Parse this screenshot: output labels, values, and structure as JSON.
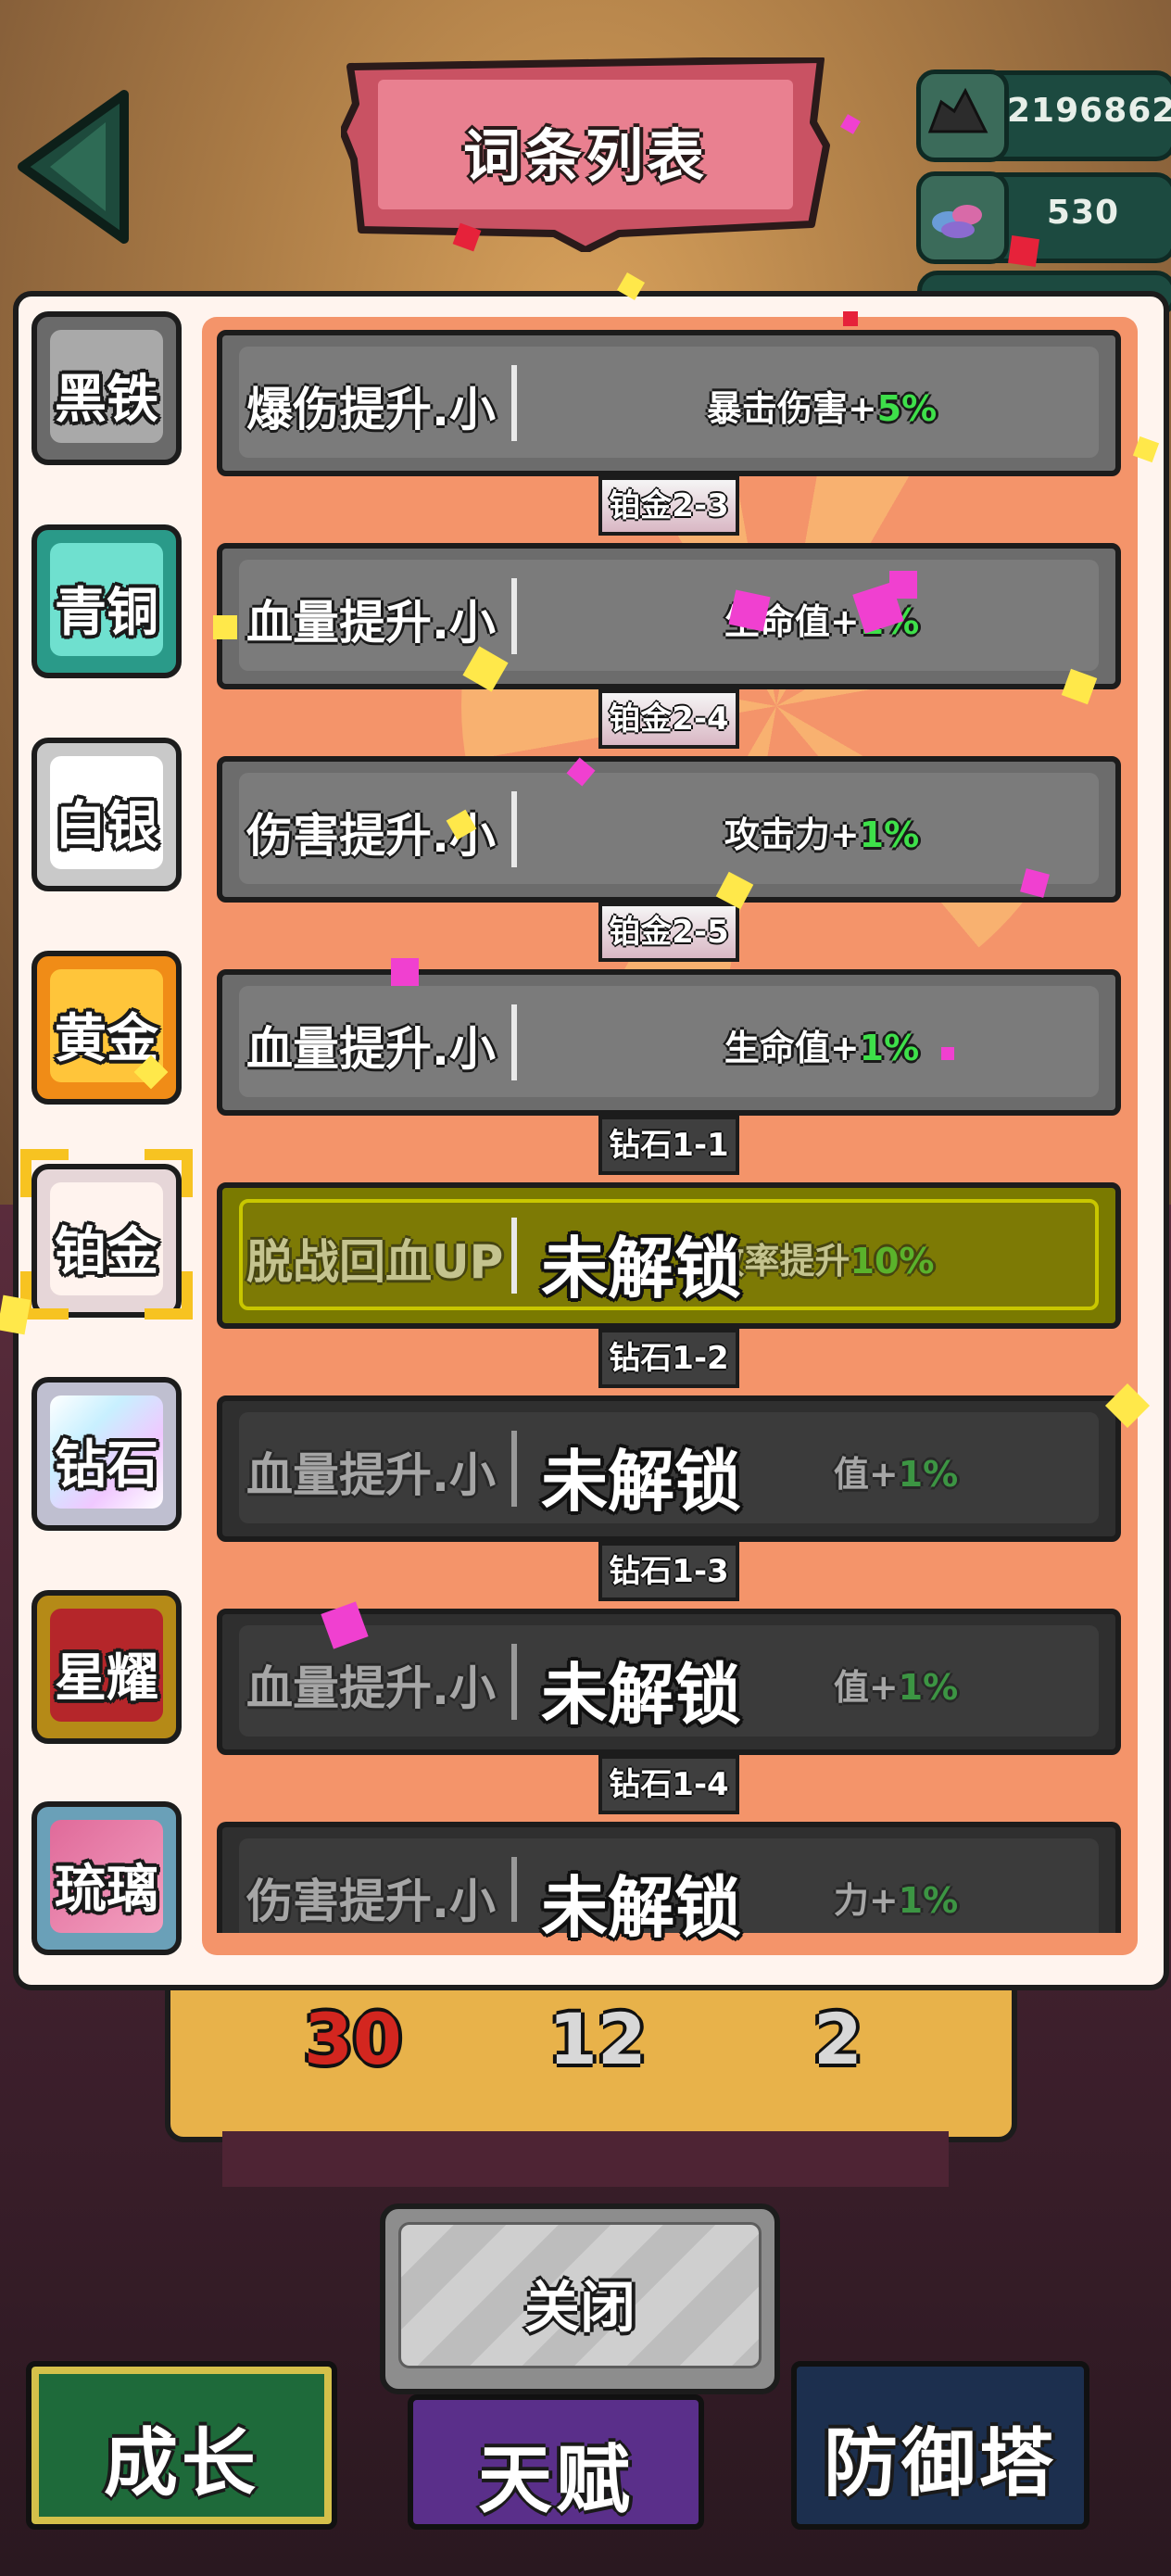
{
  "header": {
    "title": "词条列表",
    "resources": [
      {
        "icon": "coal-pile-icon",
        "value": "2196862"
      },
      {
        "icon": "gem-pile-icon",
        "value": "530"
      }
    ]
  },
  "tiers": [
    {
      "label": "黑铁",
      "color": "#8a8a8a",
      "face": "#a9a9a9"
    },
    {
      "label": "青铜",
      "color": "#3cc7b2",
      "face": "#6fe0cf"
    },
    {
      "label": "白银",
      "color": "#dcdcdc",
      "face": "#ffffff"
    },
    {
      "label": "黄金",
      "color": "#f6a423",
      "face": "#ffc53a"
    },
    {
      "label": "铂金",
      "color": "#f1e4e6",
      "face": "#fff3ee"
    },
    {
      "label": "钻石",
      "color": "#d7d7e5",
      "face": "#f2f2ff"
    },
    {
      "label": "星耀",
      "color": "#c99a1b",
      "face": "#b5262a"
    },
    {
      "label": "琉璃",
      "color": "#7bb1c8",
      "face": "#e06a9a"
    }
  ],
  "selected_tier": "铂金",
  "affixes": [
    {
      "name": "爆伤提升.小",
      "effect": "暴击伤害+",
      "pct": "5%",
      "status": "unlocked"
    },
    {
      "name": "血量提升.小",
      "effect": "生命值+",
      "pct": "1%",
      "status": "unlocked"
    },
    {
      "name": "伤害提升.小",
      "effect": "攻击力+",
      "pct": "1%",
      "status": "unlocked"
    },
    {
      "name": "血量提升.小",
      "effect": "生命值+",
      "pct": "1%",
      "status": "unlocked"
    },
    {
      "name": "脱战回血UP",
      "effect": "效率提升",
      "pct": "10%",
      "status": "locked",
      "lock_text": "未解锁"
    },
    {
      "name": "血量提升.小",
      "effect": "值+",
      "pct": "1%",
      "status": "locked",
      "lock_text": "未解锁"
    },
    {
      "name": "血量提升.小",
      "effect": "值+",
      "pct": "1%",
      "status": "locked",
      "lock_text": "未解锁"
    },
    {
      "name": "伤害提升.小",
      "effect": "力+",
      "pct": "1%",
      "status": "locked",
      "lock_text": "未解锁"
    }
  ],
  "level_tags": [
    "铂金2-3",
    "铂金2-4",
    "铂金2-5",
    "钻石1-1",
    "钻石1-2",
    "钻石1-3",
    "钻石1-4"
  ],
  "background_counts": [
    "30",
    "12",
    "2"
  ],
  "close_label": "关闭",
  "bottom_tabs": [
    "成长",
    "天赋",
    "防御塔"
  ]
}
